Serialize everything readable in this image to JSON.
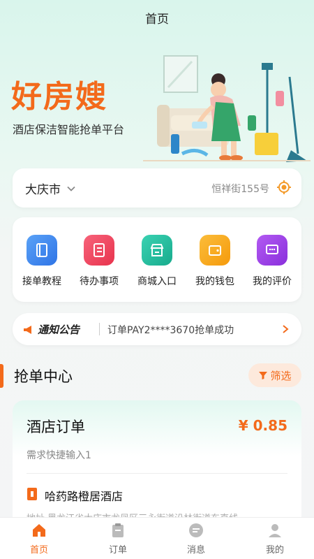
{
  "header": {
    "title": "首页"
  },
  "hero": {
    "brand": "好房嫂",
    "slogan": "酒店保洁智能抢单平台"
  },
  "location": {
    "city": "大庆市",
    "address": "恒祥街155号"
  },
  "menu": [
    {
      "label": "接单教程",
      "icon": "book-icon",
      "color": "#3a86f0"
    },
    {
      "label": "待办事项",
      "icon": "checklist-icon",
      "color": "#f0435c"
    },
    {
      "label": "商城入口",
      "icon": "store-icon",
      "color": "#23bfa0"
    },
    {
      "label": "我的钱包",
      "icon": "wallet-icon",
      "color": "#f9a418"
    },
    {
      "label": "我的评价",
      "icon": "chat-icon",
      "color": "#9c3ce6"
    }
  ],
  "notice": {
    "title": "通知公告",
    "text": "订单PAY2****3670抢单成功"
  },
  "section": {
    "title": "抢单中心",
    "filter_label": "筛选"
  },
  "order": {
    "title": "酒店订单",
    "price": "¥ 0.85",
    "subtitle": "需求快捷输入1",
    "hotel_name": "哈药路橙居酒店",
    "hotel_address": "地址 黑龙江省大庆市龙凤区三永街道沿林街道东直线"
  },
  "tabs": [
    {
      "label": "首页",
      "icon": "home-icon",
      "active": true
    },
    {
      "label": "订单",
      "icon": "clipboard-icon",
      "active": false
    },
    {
      "label": "消息",
      "icon": "message-icon",
      "active": false
    },
    {
      "label": "我的",
      "icon": "user-icon",
      "active": false
    }
  ],
  "colors": {
    "accent": "#f36a1b",
    "mint": "#d9f5ec"
  }
}
